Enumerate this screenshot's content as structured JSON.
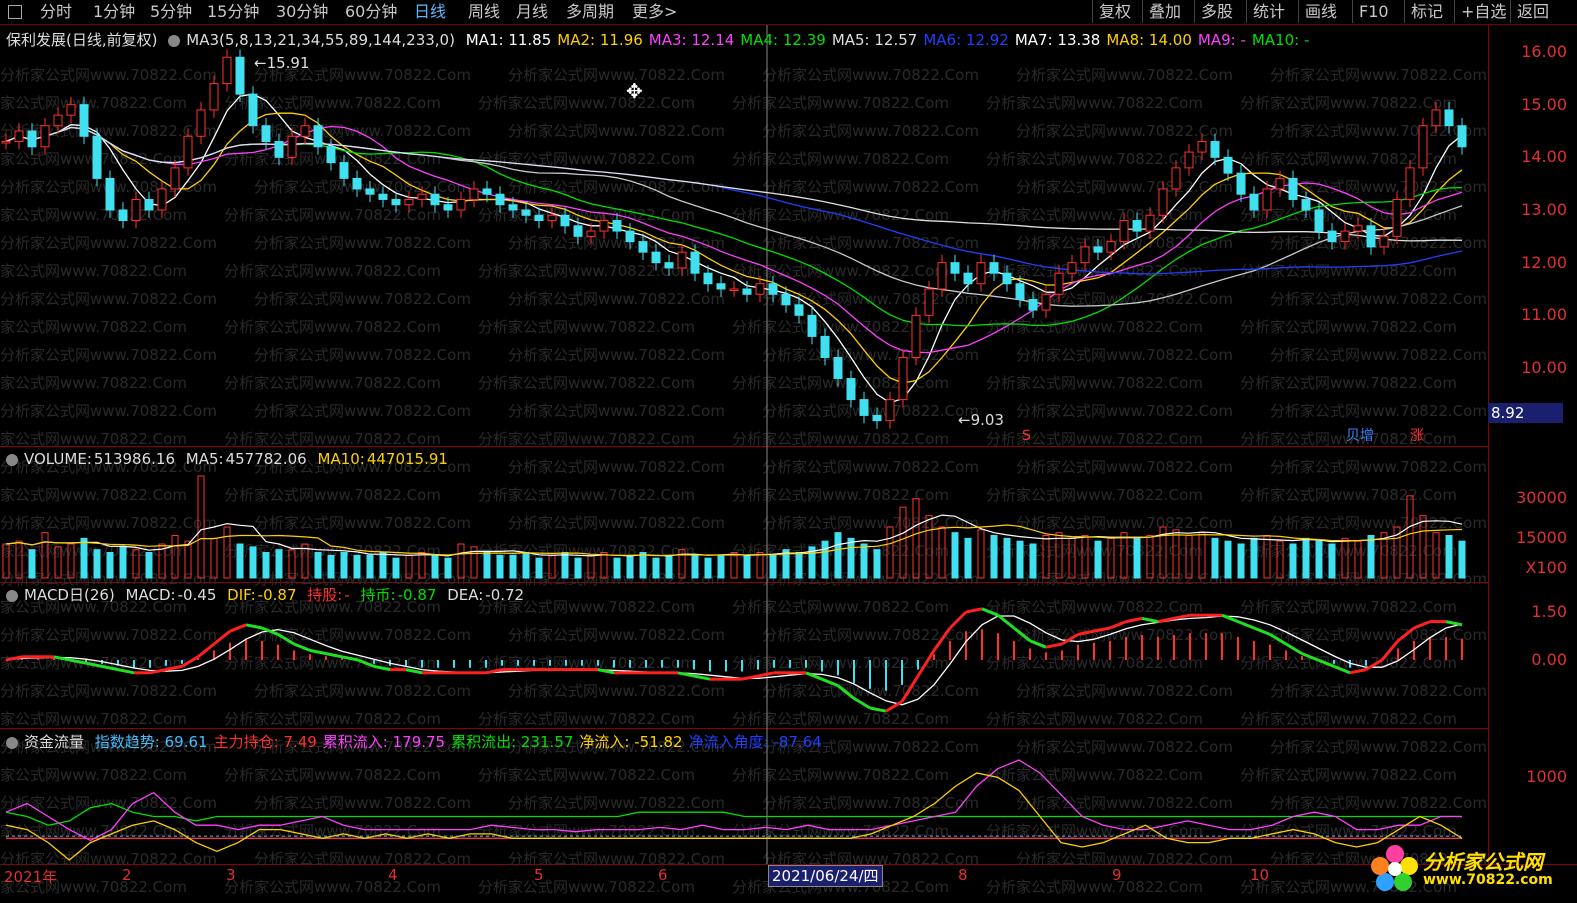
{
  "toolbar": {
    "tabs": [
      "分时",
      "1分钟",
      "5分钟",
      "15分钟",
      "30分钟",
      "60分钟",
      "日线",
      "周线",
      "月线",
      "多周期",
      "更多>"
    ],
    "active_tab": "日线",
    "right_buttons": [
      "复权",
      "叠加",
      "多股",
      "统计",
      "画线",
      "F10",
      "标记",
      "+自选",
      "返回"
    ]
  },
  "price_panel": {
    "title": "保利发展(日线,前复权)",
    "ma_params": "MA3(5,8,13,21,34,55,89,144,233,0)",
    "ma_values": [
      {
        "label": "MA1:",
        "value": "11.85",
        "color": "#ffffff"
      },
      {
        "label": "MA2:",
        "value": "11.96",
        "color": "#ffd000"
      },
      {
        "label": "MA3:",
        "value": "12.14",
        "color": "#ff40ff"
      },
      {
        "label": "MA4:",
        "value": "12.39",
        "color": "#00e000"
      },
      {
        "label": "MA5:",
        "value": "12.57",
        "color": "#dddddd"
      },
      {
        "label": "MA6:",
        "value": "12.92",
        "color": "#2040ff"
      },
      {
        "label": "MA7:",
        "value": "13.38",
        "color": "#ffffff"
      },
      {
        "label": "MA8:",
        "value": "14.00",
        "color": "#ffd000"
      },
      {
        "label": "MA9:",
        "value": "-",
        "color": "#ff40ff"
      },
      {
        "label": "MA10:",
        "value": "-",
        "color": "#00e000"
      }
    ],
    "high_label": "15.91",
    "low_label": "9.03",
    "current_price": "8.92",
    "y_ticks": [
      "16.00",
      "15.00",
      "14.00",
      "13.00",
      "12.00",
      "11.00",
      "10.00"
    ],
    "markers": [
      "S",
      "贝增",
      "涨"
    ]
  },
  "volume_panel": {
    "title": "VOLUME:",
    "value": "513986.16",
    "ma5_label": "MA5:",
    "ma5": "457782.06",
    "ma10_label": "MA10:",
    "ma10": "447015.91",
    "y_ticks": [
      "30000",
      "15000",
      "X100"
    ]
  },
  "macd_panel": {
    "title": "MACD日(26)",
    "macd_label": "MACD:",
    "macd": "-0.45",
    "dif_label": "DIF:",
    "dif": "-0.87",
    "hold_label": "持股:",
    "hold": "-",
    "coin_label": "持币:",
    "coin": "-0.87",
    "dea_label": "DEA:",
    "dea": "-0.72",
    "y_ticks": [
      "1.50",
      "0.00"
    ]
  },
  "flow_panel": {
    "title": "资金流量",
    "items": [
      {
        "label": "指数趋势:",
        "value": "69.61",
        "color": "#40c0ff"
      },
      {
        "label": "主力持仓:",
        "value": "7.49",
        "color": "#ff3030"
      },
      {
        "label": "累积流入:",
        "value": "179.75",
        "color": "#ff40ff"
      },
      {
        "label": "累积流出:",
        "value": "231.57",
        "color": "#00e000"
      },
      {
        "label": "净流入:",
        "value": "-51.82",
        "color": "#ffd000"
      },
      {
        "label": "净流入角度:",
        "value": "-87.64",
        "color": "#2040ff"
      }
    ],
    "y_ticks": [
      "1000"
    ]
  },
  "x_axis": {
    "labels": [
      "2021年",
      "2",
      "3",
      "4",
      "5",
      "6",
      "8",
      "9",
      "10"
    ],
    "cursor_date": "2021/06/24/四"
  },
  "watermark": "分析家公式网www.70822.Com",
  "logo": {
    "line1": "分析家公式网",
    "line2": "www.70822.com"
  },
  "chart_data": {
    "type": "candlestick",
    "title": "保利发展(日线,前复权)",
    "ylim": [
      8.9,
      16.3
    ],
    "close_series": [
      14.3,
      14.5,
      14.2,
      14.6,
      14.8,
      15.0,
      14.4,
      13.6,
      13.0,
      12.8,
      13.2,
      13.0,
      13.4,
      13.8,
      14.4,
      14.9,
      15.4,
      15.9,
      15.2,
      14.6,
      14.3,
      14.0,
      14.4,
      14.6,
      14.2,
      13.9,
      13.6,
      13.4,
      13.3,
      13.2,
      13.1,
      13.2,
      13.3,
      13.1,
      13.0,
      13.2,
      13.4,
      13.3,
      13.1,
      13.0,
      12.9,
      12.8,
      12.9,
      12.7,
      12.5,
      12.6,
      12.8,
      12.6,
      12.4,
      12.2,
      12.0,
      11.9,
      12.2,
      11.8,
      11.6,
      11.5,
      11.5,
      11.4,
      11.6,
      11.4,
      11.2,
      11.0,
      10.6,
      10.2,
      9.8,
      9.4,
      9.1,
      9.0,
      9.4,
      10.2,
      11.0,
      11.5,
      12.0,
      11.8,
      11.6,
      12.0,
      11.8,
      11.6,
      11.3,
      11.1,
      11.4,
      11.8,
      12.0,
      12.3,
      12.2,
      12.4,
      12.8,
      12.6,
      12.9,
      13.4,
      13.8,
      14.1,
      14.3,
      14.0,
      13.7,
      13.3,
      13.0,
      13.4,
      13.6,
      13.2,
      13.0,
      12.6,
      12.4,
      12.6,
      12.7,
      12.3,
      12.5,
      13.2,
      13.8,
      14.6,
      14.9,
      14.6,
      14.2
    ],
    "volume_series_x100": [
      12000,
      13000,
      10000,
      16000,
      11000,
      12000,
      14000,
      10000,
      9000,
      11000,
      10000,
      9000,
      12000,
      15000,
      13000,
      36000,
      14000,
      18000,
      12000,
      11000,
      9000,
      10000,
      10000,
      12000,
      9000,
      8000,
      9000,
      8000,
      8000,
      9000,
      7000,
      8000,
      9000,
      8000,
      7000,
      12000,
      11000,
      9000,
      8000,
      8000,
      9000,
      7000,
      8000,
      9000,
      7000,
      8000,
      9000,
      7000,
      8000,
      9000,
      7000,
      8000,
      10000,
      8000,
      7000,
      8000,
      9000,
      8000,
      9000,
      8000,
      10000,
      9000,
      11000,
      13000,
      16000,
      14000,
      12000,
      10000,
      18000,
      25000,
      28000,
      22000,
      18000,
      16000,
      14000,
      17000,
      15000,
      14000,
      13000,
      12000,
      15000,
      16000,
      14000,
      15000,
      13000,
      14000,
      16000,
      14000,
      15000,
      18000,
      17000,
      15000,
      16000,
      14000,
      13000,
      12000,
      14000,
      15000,
      13000,
      12000,
      14000,
      13000,
      12000,
      14000,
      13000,
      15000,
      16000,
      18000,
      29000,
      22000,
      16000,
      15000,
      13000
    ],
    "macd_dif": [
      0.0,
      0.1,
      0.1,
      0.1,
      0.0,
      -0.1,
      -0.2,
      -0.3,
      -0.4,
      -0.4,
      -0.3,
      -0.2,
      0.1,
      0.5,
      0.9,
      1.1,
      1.0,
      0.8,
      0.5,
      0.3,
      0.2,
      0.1,
      0.0,
      -0.2,
      -0.3,
      -0.3,
      -0.4,
      -0.4,
      -0.4,
      -0.4,
      -0.4,
      -0.3,
      -0.3,
      -0.3,
      -0.3,
      -0.3,
      -0.3,
      -0.3,
      -0.4,
      -0.4,
      -0.4,
      -0.4,
      -0.4,
      -0.5,
      -0.6,
      -0.6,
      -0.6,
      -0.5,
      -0.4,
      -0.4,
      -0.4,
      -0.6,
      -0.8,
      -1.2,
      -1.5,
      -1.6,
      -1.3,
      -0.5,
      0.3,
      1.0,
      1.5,
      1.6,
      1.4,
      1.0,
      0.6,
      0.4,
      0.5,
      0.8,
      0.9,
      1.0,
      1.2,
      1.3,
      1.2,
      1.3,
      1.4,
      1.4,
      1.4,
      1.2,
      1.0,
      0.8,
      0.5,
      0.2,
      0.0,
      -0.2,
      -0.4,
      -0.3,
      0.0,
      0.6,
      1.0,
      1.2,
      1.2,
      1.1
    ],
    "flow_series": {
      "accumulated_inflow": [
        780,
        820,
        760,
        700,
        650,
        700,
        820,
        870,
        780,
        720,
        720,
        700,
        720,
        720,
        740,
        760,
        720,
        700,
        700,
        700,
        700,
        700,
        700,
        720,
        710,
        700,
        700,
        690,
        700,
        700,
        700,
        710,
        700,
        720,
        700,
        700,
        710,
        700,
        720,
        700,
        700,
        700,
        720,
        740,
        760,
        780,
        900,
        980,
        1020,
        960,
        860,
        760,
        720,
        700,
        700,
        720,
        740,
        720,
        700,
        700,
        720,
        760,
        780,
        760,
        700,
        700,
        720,
        720,
        760,
        760
      ],
      "accumulated_outflow": [
        780,
        760,
        720,
        740,
        800,
        820,
        780,
        760,
        760,
        740,
        760,
        760,
        760,
        760,
        760,
        760,
        760,
        760,
        760,
        760,
        760,
        760,
        760,
        760,
        760,
        760,
        760,
        760,
        760,
        760,
        780,
        780,
        780,
        780,
        780,
        760,
        760,
        760,
        760,
        760,
        760,
        760,
        760,
        760,
        760,
        760,
        760,
        760,
        760,
        760,
        760,
        760,
        760,
        760,
        760,
        760,
        760,
        760,
        760,
        760,
        760,
        760,
        760,
        760,
        760,
        760,
        760,
        760,
        760,
        760
      ],
      "net_inflow": [
        720,
        700,
        640,
        560,
        640,
        680,
        720,
        740,
        700,
        640,
        600,
        640,
        700,
        700,
        680,
        660,
        680,
        660,
        680,
        660,
        680,
        660,
        680,
        680,
        660,
        660,
        660,
        660,
        660,
        660,
        660,
        660,
        660,
        660,
        660,
        660,
        660,
        660,
        660,
        660,
        660,
        680,
        720,
        760,
        820,
        900,
        960,
        940,
        880,
        760,
        640,
        620,
        640,
        680,
        720,
        660,
        640,
        640,
        660,
        660,
        680,
        700,
        680,
        640,
        620,
        640,
        700,
        760,
        720,
        660
      ],
      "main_position": [
        660,
        660,
        660,
        660,
        660,
        660,
        660,
        660,
        660,
        660,
        660,
        660,
        660,
        660,
        660,
        660,
        660,
        660,
        660,
        660,
        660,
        660,
        660,
        660,
        660,
        660,
        660,
        660,
        660,
        660,
        660,
        660,
        660,
        660,
        660,
        660,
        660,
        660,
        660,
        660,
        660,
        660,
        660,
        660,
        660,
        660,
        660,
        660,
        660,
        660,
        660,
        660,
        660,
        660,
        660,
        660,
        660,
        660,
        660,
        660,
        660,
        660,
        660,
        660,
        660,
        660,
        660,
        660,
        660,
        660
      ]
    }
  }
}
